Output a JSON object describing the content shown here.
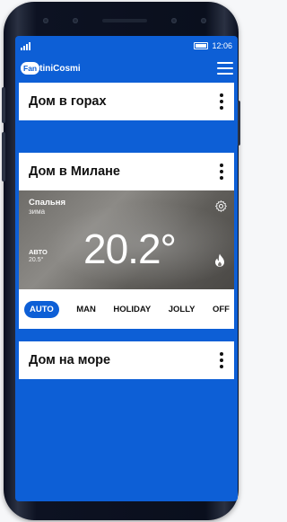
{
  "status_bar": {
    "time": "12:06"
  },
  "app": {
    "logo_badge": "Fan",
    "logo_rest": "tiniCosmi"
  },
  "homes": [
    {
      "title": "Дом в горах"
    },
    {
      "title": "Дом в Милане",
      "room": {
        "name": "Спальня",
        "season": "зима",
        "mode": "АВТО",
        "setpoint": "20.5°",
        "temperature": "20.2°"
      },
      "modes": [
        "AUTO",
        "MAN",
        "HOLIDAY",
        "JOLLY",
        "OFF"
      ],
      "active_mode": "AUTO"
    },
    {
      "title": "Дом на море"
    }
  ],
  "colors": {
    "accent": "#0d5fd6",
    "card": "#ffffff",
    "text": "#111111"
  },
  "icons": [
    "signal-icon",
    "battery-icon",
    "menu-icon",
    "more-vert-icon",
    "gear-icon",
    "flame-icon"
  ]
}
